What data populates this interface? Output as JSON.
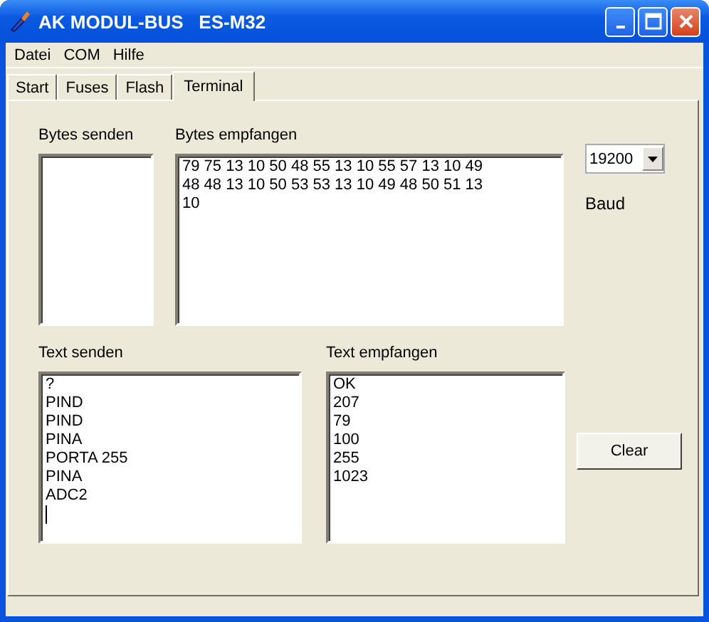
{
  "window": {
    "title": "AK MODUL-BUS   ES-M32"
  },
  "menu": [
    "Datei",
    "COM",
    "Hilfe"
  ],
  "tabs": [
    {
      "label": "Start",
      "selected": false
    },
    {
      "label": "Fuses",
      "selected": false
    },
    {
      "label": "Flash",
      "selected": false
    },
    {
      "label": "Terminal",
      "selected": true
    }
  ],
  "bytes_send": {
    "label": "Bytes senden"
  },
  "bytes_received": {
    "label": "Bytes empfangen",
    "lines": [
      "79 75 13 10 50 48 55 13 10 55 57 13 10 49",
      "48 48 13 10 50 53 53 13 10 49 48 50 51 13",
      "10"
    ]
  },
  "baud": {
    "value": "19200",
    "label": "Baud"
  },
  "text_send": {
    "label": "Text senden",
    "lines": [
      "?",
      "PIND",
      "PIND",
      "PINA",
      "PORTA 255",
      "PINA",
      "ADC2"
    ],
    "cursor": true
  },
  "text_received": {
    "label": "Text empfangen",
    "lines": [
      "OK",
      "207",
      "79",
      "100",
      "255",
      "1023"
    ]
  },
  "clear_button": "Clear"
}
